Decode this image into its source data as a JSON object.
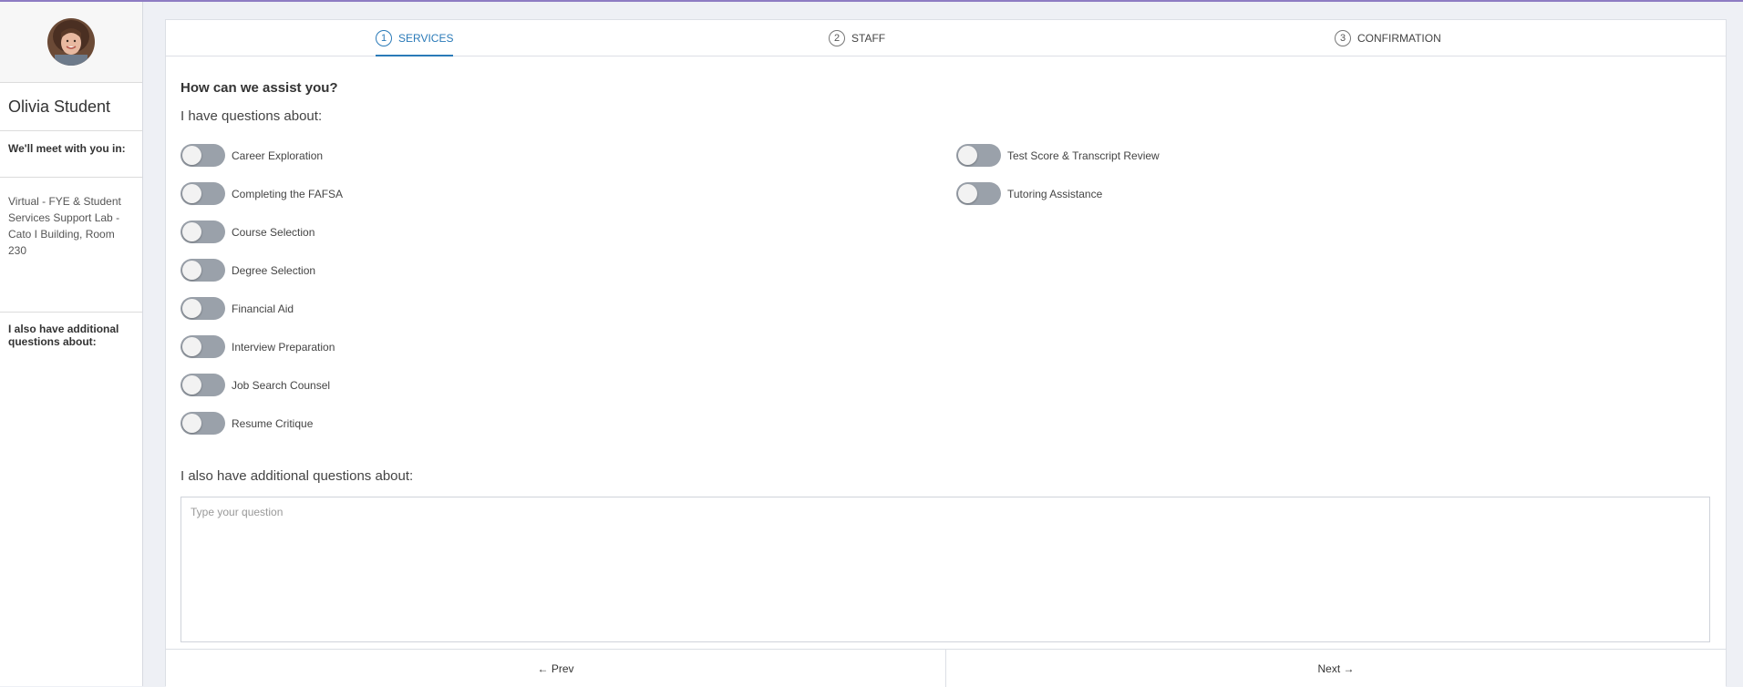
{
  "sidebar": {
    "user_name": "Olivia Student",
    "meet_label": "We'll meet with you in:",
    "location": "Virtual - FYE & Student Services Support Lab - Cato I Building, Room 230",
    "also_label": "I also have additional questions about:"
  },
  "steps": [
    {
      "number": "1",
      "label": "SERVICES",
      "active": true
    },
    {
      "number": "2",
      "label": "STAFF",
      "active": false
    },
    {
      "number": "3",
      "label": "CONFIRMATION",
      "active": false
    }
  ],
  "form": {
    "heading": "How can we assist you?",
    "subheading": "I have questions about:",
    "services": [
      {
        "label": "Career Exploration",
        "on": false
      },
      {
        "label": "Completing the FAFSA",
        "on": false
      },
      {
        "label": "Course Selection",
        "on": false
      },
      {
        "label": "Degree Selection",
        "on": false
      },
      {
        "label": "Financial Aid",
        "on": false
      },
      {
        "label": "Interview Preparation",
        "on": false
      },
      {
        "label": "Job Search Counsel",
        "on": false
      },
      {
        "label": "Resume Critique",
        "on": false
      },
      {
        "label": "Test Score & Transcript Review",
        "on": false
      },
      {
        "label": "Tutoring Assistance",
        "on": false
      }
    ],
    "additional_heading": "I also have additional questions about:",
    "question_placeholder": "Type your question",
    "question_value": ""
  },
  "footer": {
    "prev_label": "← Prev",
    "next_label": "Next →"
  },
  "colors": {
    "accent": "#2a7ab8",
    "toggle_off": "#9aa1aa",
    "top_line": "#8e7cc3"
  }
}
